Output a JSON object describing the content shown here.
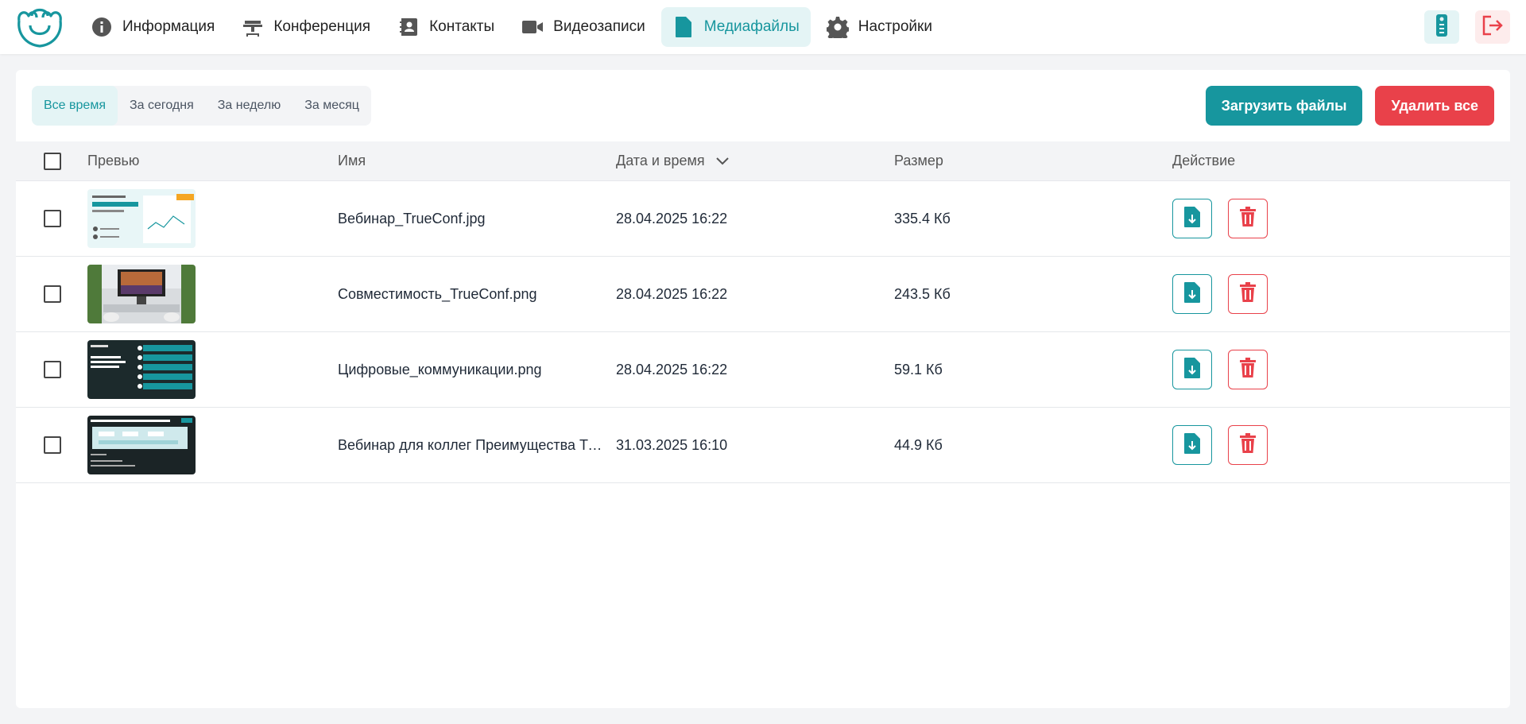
{
  "nav": {
    "items": [
      {
        "label": "Информация",
        "icon": "info-icon"
      },
      {
        "label": "Конференция",
        "icon": "conference-icon"
      },
      {
        "label": "Контакты",
        "icon": "contacts-icon"
      },
      {
        "label": "Видеозаписи",
        "icon": "video-camera-icon"
      },
      {
        "label": "Медиафайлы",
        "icon": "document-icon",
        "active": true
      },
      {
        "label": "Настройки",
        "icon": "gear-icon"
      }
    ]
  },
  "top_right": {
    "remote_icon": "remote-control-icon",
    "logout_icon": "logout-icon"
  },
  "filters": [
    "Все время",
    "За сегодня",
    "За неделю",
    "За месяц"
  ],
  "active_filter": "Все время",
  "buttons": {
    "upload": "Загрузить файлы",
    "delete_all": "Удалить все"
  },
  "table": {
    "headers": {
      "preview": "Превью",
      "name": "Имя",
      "date": "Дата и время",
      "size": "Размер",
      "action": "Действие"
    },
    "rows": [
      {
        "name": "Вебинар_TrueConf.jpg",
        "date": "28.04.2025 16:22",
        "size": "335.4 Кб"
      },
      {
        "name": "Совместимость_TrueConf.png",
        "date": "28.04.2025 16:22",
        "size": "243.5 Кб"
      },
      {
        "name": "Цифровые_коммуникации.png",
        "date": "28.04.2025 16:22",
        "size": "59.1 Кб"
      },
      {
        "name": "Вебинар для коллег Преимущества TrueConf.png",
        "date": "31.03.2025 16:10",
        "size": "44.9 Кб"
      }
    ]
  },
  "colors": {
    "accent": "#17969e",
    "danger": "#e9414a"
  }
}
